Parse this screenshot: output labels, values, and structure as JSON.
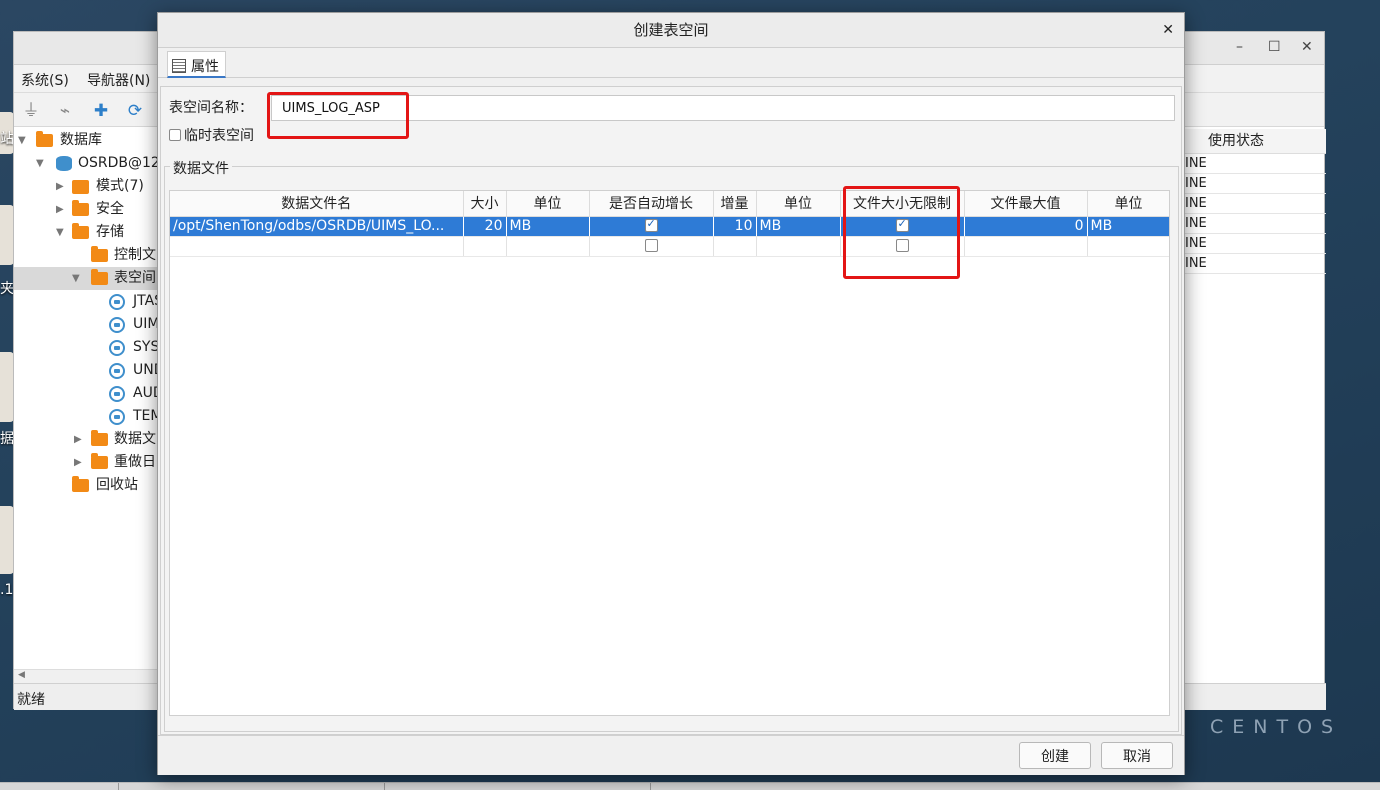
{
  "desktop": {
    "left_labels": [
      "站",
      "夹",
      "据",
      ".1"
    ],
    "brand": "CENTOS"
  },
  "main_window": {
    "menu": [
      "系统(S)",
      "导航器(N)"
    ],
    "controls": {
      "minimize": "–",
      "maximize": "☐",
      "close": "✕"
    },
    "tree": {
      "root": "数据库",
      "connection": "OSRDB@12",
      "schema": "模式(7)",
      "security": "安全",
      "storage": "存储",
      "control_file": "控制文",
      "tablespaces": "表空间",
      "tablespace_items": [
        "JTAS",
        "UIM",
        "SYS",
        "UND",
        "AUD",
        "TEM"
      ],
      "datafiles": "数据文",
      "redo": "重做日",
      "recycle": "回收站"
    },
    "right_column": {
      "header": "使用状态",
      "values": [
        "INE",
        "INE",
        "INE",
        "INE",
        "INE",
        "INE"
      ]
    },
    "status": "就绪"
  },
  "dialog": {
    "title": "创建表空间",
    "close": "✕",
    "tab": "属性",
    "name_label": "表空间名称：",
    "name_value": "UIMS_LOG_ASP",
    "temp_label": "临时表空间",
    "temp_checked": false,
    "datafile_section": "数据文件",
    "columns": [
      "数据文件名",
      "大小",
      "单位",
      "是否自动增长",
      "增量",
      "单位",
      "文件大小无限制",
      "文件最大值",
      "单位"
    ],
    "rows": [
      {
        "file": "/opt/ShenTong/odbs/OSRDB/UIMS_LO...",
        "size": "20",
        "size_unit": "MB",
        "autoextend": true,
        "increment": "10",
        "inc_unit": "MB",
        "unlimited": true,
        "max": "0",
        "max_unit": "MB"
      },
      {
        "file": "",
        "size": "",
        "size_unit": "",
        "autoextend": false,
        "increment": "",
        "inc_unit": "",
        "unlimited": false,
        "max": "",
        "max_unit": ""
      }
    ],
    "buttons": {
      "create": "创建",
      "cancel": "取消"
    }
  },
  "highlight_color": "#e31515",
  "selection_color": "#2e7bd6"
}
